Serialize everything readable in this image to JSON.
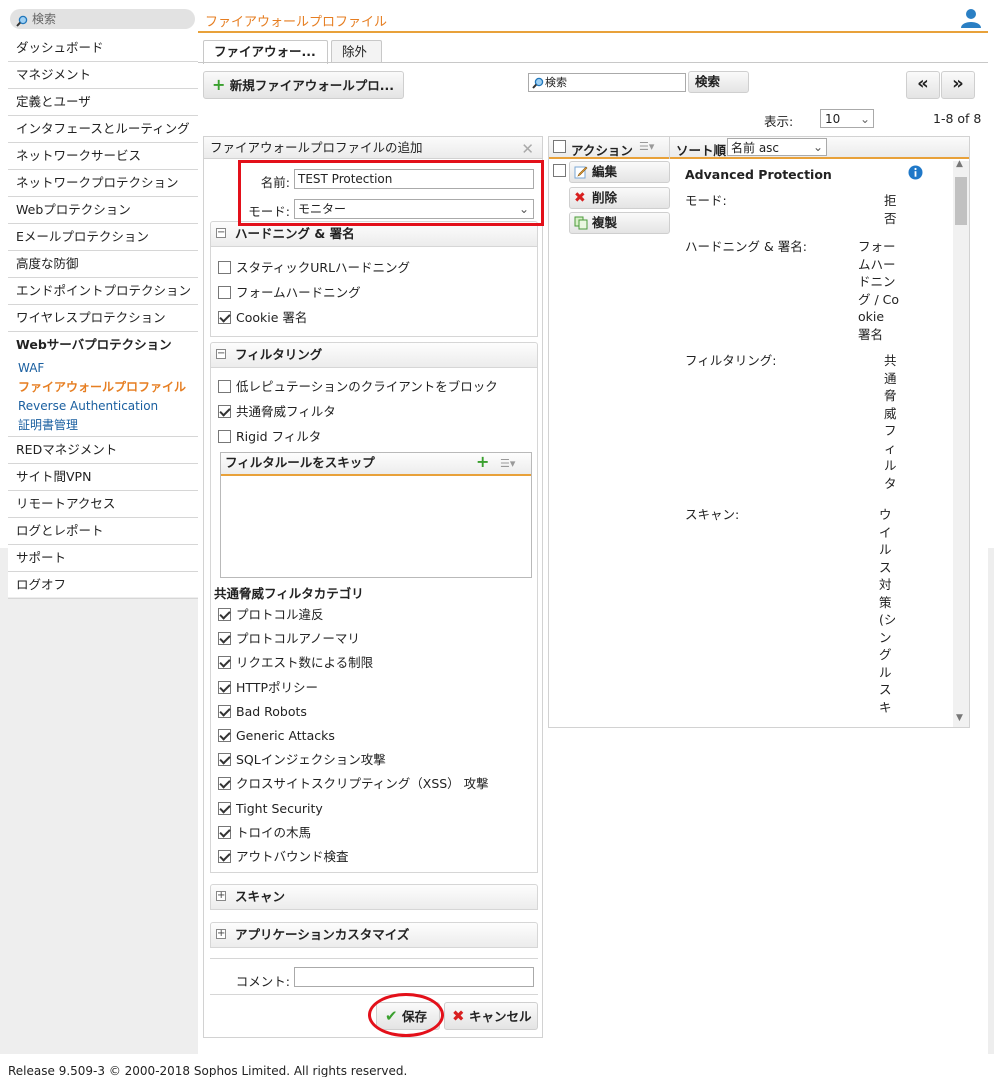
{
  "header": {
    "search_placeholder": "検索",
    "page_title": "ファイアウォールプロファイル"
  },
  "sidebar": {
    "items_top": [
      "ダッシュボード",
      "マネジメント",
      "定義とユーザ",
      "インタフェースとルーティング",
      "ネットワークサービス",
      "ネットワークプロテクション",
      "Webプロテクション",
      "Eメールプロテクション",
      "高度な防御",
      "エンドポイントプロテクション",
      "ワイヤレスプロテクション"
    ],
    "active_group": "Webサーバプロテクション",
    "sub_items": [
      "WAF",
      "ファイアウォールプロファイル",
      "Reverse Authentication",
      "証明書管理"
    ],
    "current_sub": "ファイアウォールプロファイル",
    "items_bottom": [
      "REDマネジメント",
      "サイト間VPN",
      "リモートアクセス",
      "ログとレポート",
      "サポート",
      "ログオフ"
    ]
  },
  "tabs": [
    "ファイアウォー...",
    "除外"
  ],
  "toolbar": {
    "new_button": "新規ファイアウォールプロ...",
    "search_placeholder": "検索",
    "search_button": "検索",
    "prev": "«",
    "next": "»",
    "display_label": "表示:",
    "page_size": "10",
    "range": "1-8 of 8"
  },
  "form": {
    "title": "ファイアウォールプロファイルの追加",
    "name_label": "名前:",
    "name_value": "TEST Protection",
    "mode_label": "モード:",
    "mode_value": "モニター",
    "hardening": {
      "title": "ハードニング & 署名",
      "options": [
        {
          "label": "スタティックURLハードニング",
          "checked": false
        },
        {
          "label": "フォームハードニング",
          "checked": false
        },
        {
          "label": "Cookie 署名",
          "checked": true
        }
      ]
    },
    "filtering": {
      "title": "フィルタリング",
      "options": [
        {
          "label": "低レピュテーションのクライアントをブロック",
          "checked": false
        },
        {
          "label": "共通脅威フィルタ",
          "checked": true
        },
        {
          "label": "Rigid フィルタ",
          "checked": false
        }
      ],
      "skip_title": "フィルタルールをスキップ",
      "category_title": "共通脅威フィルタカテゴリ",
      "categories": [
        {
          "label": "プロトコル違反",
          "checked": true
        },
        {
          "label": "プロトコルアノーマリ",
          "checked": true
        },
        {
          "label": "リクエスト数による制限",
          "checked": true
        },
        {
          "label": "HTTPポリシー",
          "checked": true
        },
        {
          "label": "Bad Robots",
          "checked": true
        },
        {
          "label": "Generic Attacks",
          "checked": true
        },
        {
          "label": "SQLインジェクション攻撃",
          "checked": true
        },
        {
          "label": "クロスサイトスクリプティング（XSS） 攻撃",
          "checked": true
        },
        {
          "label": "Tight Security",
          "checked": true
        },
        {
          "label": "トロイの木馬",
          "checked": true
        },
        {
          "label": "アウトバウンド検査",
          "checked": true
        }
      ]
    },
    "scan_title": "スキャン",
    "app_title": "アプリケーションカスタマイズ",
    "comment_label": "コメント:",
    "save": "保存",
    "cancel": "キャンセル"
  },
  "list": {
    "action_header": "アクション",
    "sort_label": "ソート順:",
    "sort_value": "名前 asc",
    "row_buttons": [
      "編集",
      "削除",
      "複製"
    ],
    "item": {
      "name": "Advanced Protection",
      "mode_label": "モード:",
      "mode_value": "拒否",
      "hardening_label": "ハードニング & 署名:",
      "hardening_value": "フォームハードニング / Cookie 署名",
      "filtering_label": "フィルタリング:",
      "filtering_value": "共通脅威フィルタ",
      "scan_label": "スキャン:",
      "scan_value": "ウイルス対策(シングルスキ"
    }
  },
  "footer": "Release 9.509-3  © 2000-2018 Sophos Limited. All rights reserved."
}
